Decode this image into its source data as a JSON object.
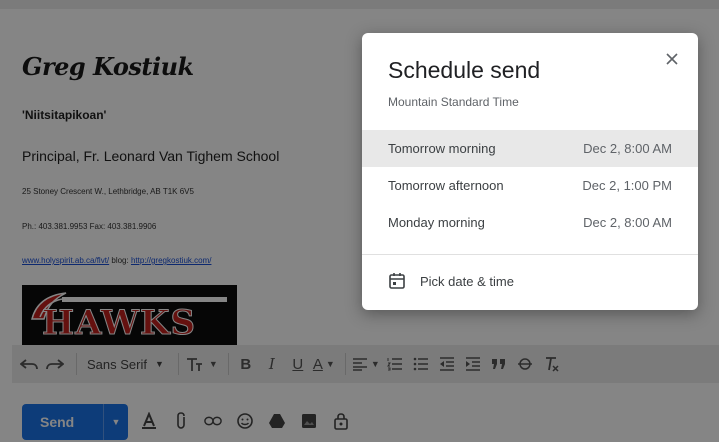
{
  "signature": {
    "name": "Greg Kostiuk",
    "native_name": "'Niitsitapikoan'",
    "title": "Principal, Fr. Leonard Van Tighem School",
    "address": "25 Stoney Crescent W., Lethbridge, AB    T1K 6V5",
    "phone": "Ph.: 403.381.9953   Fax: 403.381.9906",
    "website": "www.holyspirit.ab.ca/flvt/",
    "blog_label": "blog:",
    "blog_url": "http://gregkostiuk.com/",
    "logo_text": "HAWKS"
  },
  "toolbar": {
    "font": "Sans Serif",
    "bold": "B",
    "italic": "I",
    "underline": "U",
    "text_color": "A"
  },
  "send_bar": {
    "send_label": "Send"
  },
  "dialog": {
    "title": "Schedule send",
    "timezone": "Mountain Standard Time",
    "options": [
      {
        "label": "Tomorrow morning",
        "date": "Dec 2, 8:00 AM",
        "highlighted": true
      },
      {
        "label": "Tomorrow afternoon",
        "date": "Dec 2, 1:00 PM",
        "highlighted": false
      },
      {
        "label": "Monday morning",
        "date": "Dec 2, 8:00 AM",
        "highlighted": false
      }
    ],
    "pick_label": "Pick date & time"
  },
  "colors": {
    "send_blue": "#1a73e8",
    "logo_red": "#c2221e",
    "highlight": "#e8e8e8"
  }
}
